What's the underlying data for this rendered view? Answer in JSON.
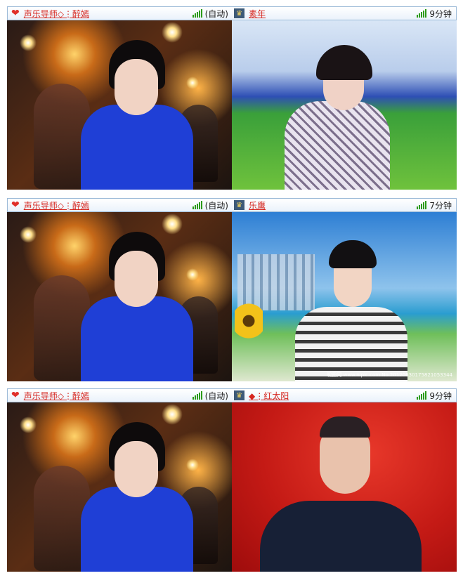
{
  "panels": [
    {
      "left_user": "声乐导师◇⋮醉嫣",
      "mode": "(自动)",
      "right_user": "素年",
      "duration": "9分钟",
      "right_bg": "meadow"
    },
    {
      "left_user": "声乐导师◇⋮醉嫣",
      "mode": "(自动)",
      "right_user": "乐鹰",
      "duration": "7分钟",
      "right_bg": "city",
      "watermark": "昵图网 www.nipic.com    No.20120630175821053344"
    },
    {
      "left_user": "声乐导师◇⋮醉嫣",
      "mode": "(自动)",
      "right_user": "◆⋮红太阳",
      "duration": "9分钟",
      "right_bg": "red"
    }
  ],
  "icons": {
    "heart": "heart-icon",
    "signal": "signal-icon",
    "rank": "rank-badge-icon"
  },
  "colors": {
    "username": "#d6261f",
    "signal": "#2d9b1a",
    "bar_border": "#9dbbd8"
  }
}
